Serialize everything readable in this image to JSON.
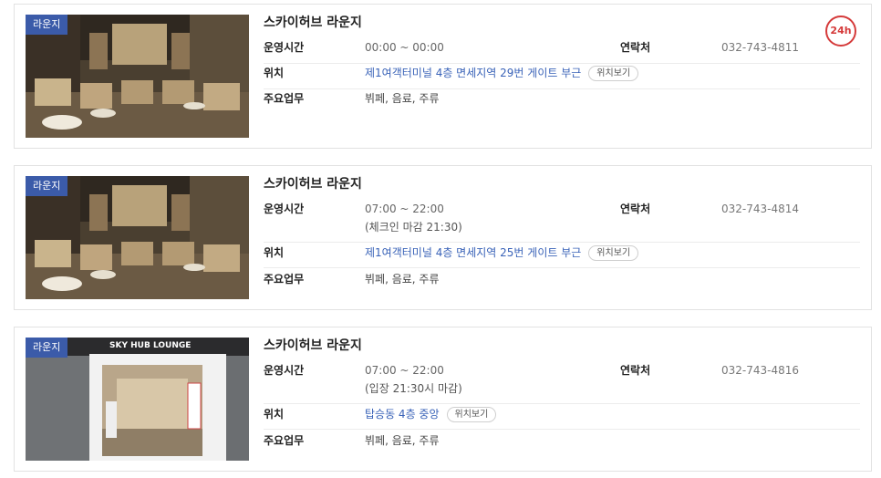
{
  "lounges": [
    {
      "badge": "라운지",
      "name": "스카이허브 라운지",
      "hours_label": "운영시간",
      "hours": "00:00 ~ 00:00",
      "hours_note": "",
      "contact_label": "연락처",
      "phone": "032-743-4811",
      "location_label": "위치",
      "location": "제1여객터미널 4층 면세지역 29번 게이트 부근",
      "location_button": "위치보기",
      "services_label": "주요업무",
      "services": "뷔페, 음료, 주류",
      "hours_badge": "24h",
      "image_icon": "lounge-interior-photo"
    },
    {
      "badge": "라운지",
      "name": "스카이허브 라운지",
      "hours_label": "운영시간",
      "hours": "07:00 ~ 22:00",
      "hours_note": "(체크인 마감 21:30)",
      "contact_label": "연락처",
      "phone": "032-743-4814",
      "location_label": "위치",
      "location": "제1여객터미널 4층 면세지역 25번 게이트 부근",
      "location_button": "위치보기",
      "services_label": "주요업무",
      "services": "뷔페, 음료, 주류",
      "image_icon": "lounge-interior-photo"
    },
    {
      "badge": "라운지",
      "name": "스카이허브 라운지",
      "hours_label": "운영시간",
      "hours": "07:00 ~ 22:00",
      "hours_note": "(입장 21:30시 마감)",
      "contact_label": "연락처",
      "phone": "032-743-4816",
      "location_label": "위치",
      "location": "탑승동 4층 중앙",
      "location_button": "위치보기",
      "services_label": "주요업무",
      "services": "뷔페, 음료, 주류",
      "image_icon": "lounge-entrance-photo",
      "image_sign": "SKY HUB LOUNGE"
    }
  ],
  "colors": {
    "badge_bg": "#3b5ba9",
    "link": "#3a63b8",
    "hours24": "#d53a3a"
  }
}
